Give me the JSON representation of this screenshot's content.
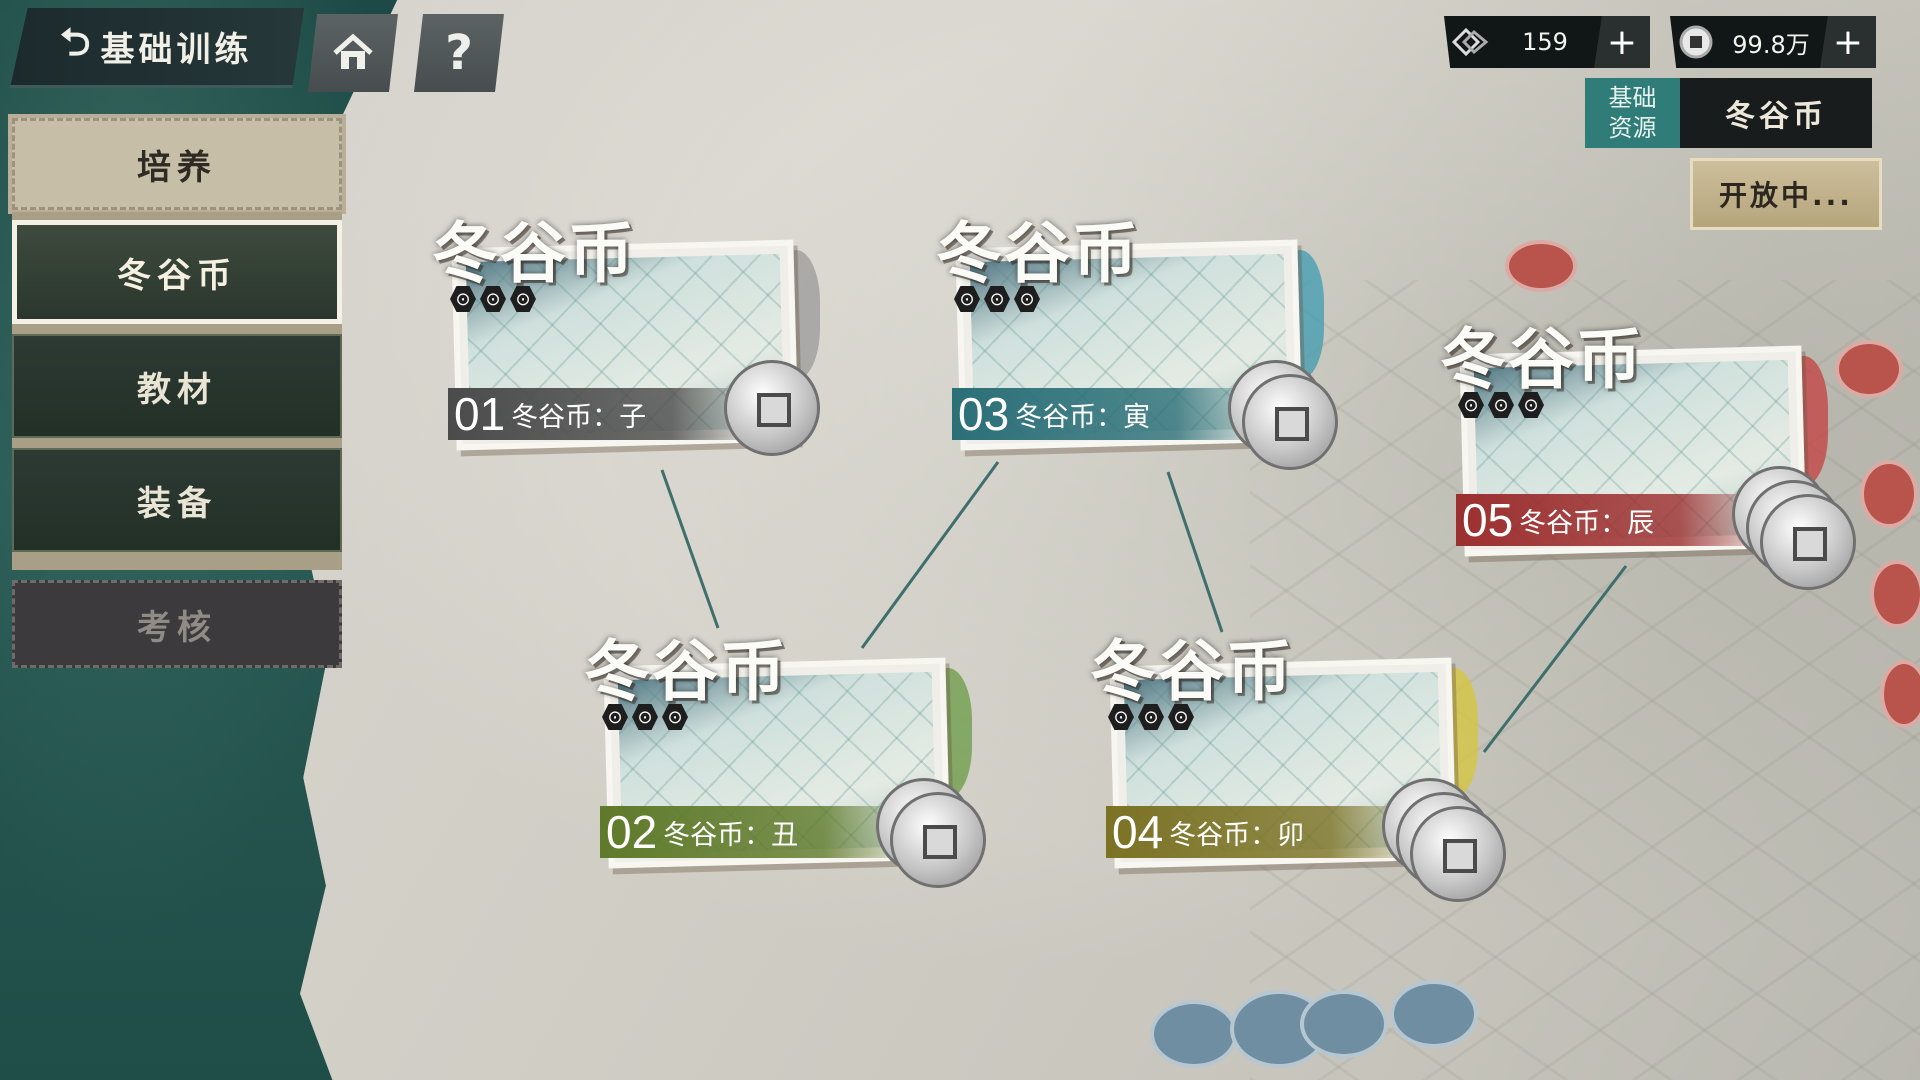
{
  "header": {
    "back_title": "基础训练",
    "help_symbol": "?"
  },
  "menu": {
    "category": "培养",
    "items": [
      "冬谷币",
      "教材",
      "装备"
    ],
    "active_index": 0,
    "exam": "考核"
  },
  "currency": {
    "gems": "159",
    "coins": "99.8万",
    "plus": "+"
  },
  "resource": {
    "label": "基础\n资源",
    "label_line1": "基础",
    "label_line2": "资源",
    "name": "冬谷币",
    "status": "开放中..."
  },
  "stages": [
    {
      "title": "冬谷币",
      "num": "01",
      "text": "冬谷币：子",
      "color": "#4b4b4b",
      "splash": "#9a9a9a"
    },
    {
      "title": "冬谷币",
      "num": "02",
      "text": "冬谷币：丑",
      "color": "#5f7a2a",
      "splash": "#6a9a45"
    },
    {
      "title": "冬谷币",
      "num": "03",
      "text": "冬谷币：寅",
      "color": "#2b6f78",
      "splash": "#3f9bb0"
    },
    {
      "title": "冬谷币",
      "num": "04",
      "text": "冬谷币：卯",
      "color": "#7b7224",
      "splash": "#d6c53a"
    },
    {
      "title": "冬谷币",
      "num": "05",
      "text": "冬谷币：辰",
      "color": "#9c2f2f",
      "splash": "#c44040"
    }
  ],
  "stage_dots": "⊙",
  "colors": {
    "accent_teal": "#2f7c78",
    "line": "#3e6f6c"
  }
}
